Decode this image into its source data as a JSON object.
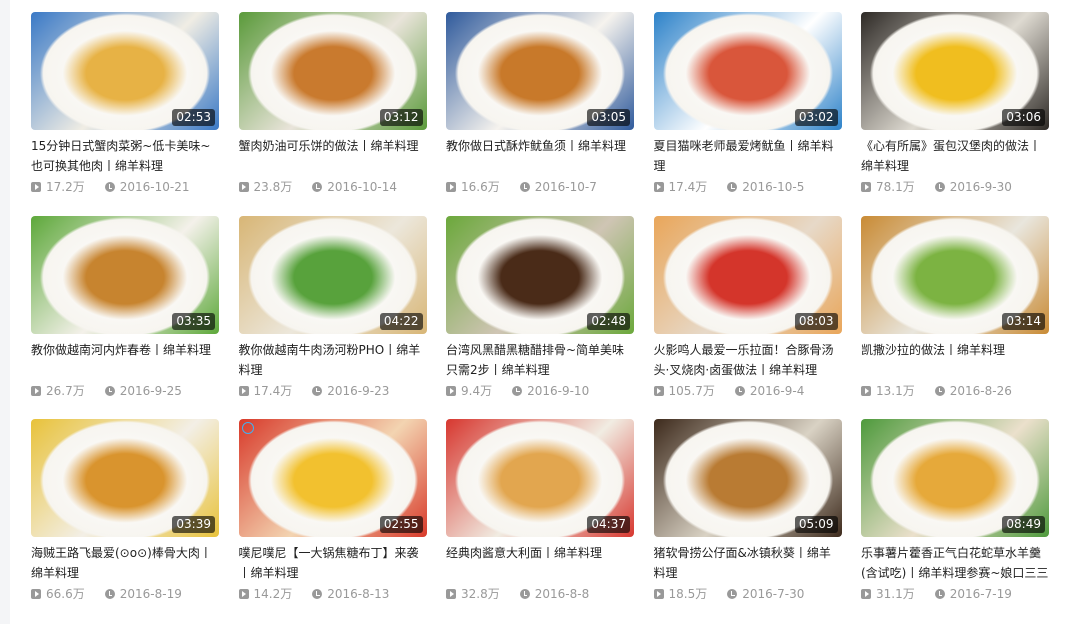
{
  "videos": [
    {
      "title": "15分钟日式蟹肉菜粥~低卡美味~也可换其他肉丨绵羊料理",
      "duration": "02:53",
      "plays": "17.2万",
      "date": "2016-10-21",
      "thumb_colors": [
        "#f0ede4",
        "#e7b245",
        "#3a79c6"
      ]
    },
    {
      "title": "蟹肉奶油可乐饼的做法丨绵羊料理",
      "duration": "03:12",
      "plays": "23.8万",
      "date": "2016-10-14",
      "thumb_colors": [
        "#e9e4da",
        "#c97a2e",
        "#5a9a3a"
      ]
    },
    {
      "title": "教你做日式酥炸鱿鱼须丨绵羊料理",
      "duration": "03:05",
      "plays": "16.6万",
      "date": "2016-10-7",
      "thumb_colors": [
        "#f6f3ee",
        "#c8792a",
        "#2f5a9c"
      ]
    },
    {
      "title": "夏目猫咪老师最爱烤鱿鱼丨绵羊料理",
      "duration": "03:02",
      "plays": "17.4万",
      "date": "2016-10-5",
      "thumb_colors": [
        "#ffffff",
        "#d9563b",
        "#2d82c9"
      ]
    },
    {
      "title": "《心有所属》蛋包汉堡肉的做法丨绵羊料理",
      "duration": "03:06",
      "plays": "78.1万",
      "date": "2016-9-30",
      "thumb_colors": [
        "#dedad1",
        "#f0be1f",
        "#2e2a26"
      ]
    },
    {
      "title": "教你做越南河内炸春卷丨绵羊料理",
      "duration": "03:35",
      "plays": "26.7万",
      "date": "2016-9-25",
      "thumb_colors": [
        "#f4f1ea",
        "#c7842f",
        "#5da83a"
      ]
    },
    {
      "title": "教你做越南牛肉汤河粉PHO丨绵羊料理",
      "duration": "04:22",
      "plays": "17.4万",
      "date": "2016-9-23",
      "thumb_colors": [
        "#ece7db",
        "#58a23c",
        "#d8b676"
      ]
    },
    {
      "title": "台湾风黑醋黑糖醋排骨~简单美味只需2步丨绵羊料理",
      "duration": "02:48",
      "plays": "9.4万",
      "date": "2016-9-10",
      "thumb_colors": [
        "#cfc5b4",
        "#4a2b18",
        "#6ba83b"
      ]
    },
    {
      "title": "火影鸣人最爱一乐拉面！合豚骨汤头·叉烧肉·卤蛋做法丨绵羊料理",
      "duration": "08:03",
      "plays": "105.7万",
      "date": "2016-9-4",
      "thumb_colors": [
        "#e7d9c8",
        "#d4352b",
        "#e9a65a"
      ]
    },
    {
      "title": "凯撒沙拉的做法丨绵羊料理",
      "duration": "03:14",
      "plays": "13.1万",
      "date": "2016-8-26",
      "thumb_colors": [
        "#e9e6dd",
        "#7cb342",
        "#c98b35"
      ]
    },
    {
      "title": "海贼王路飞最爱(⊙o⊙)棒骨大肉丨绵羊料理",
      "duration": "03:39",
      "plays": "66.6万",
      "date": "2016-8-19",
      "thumb_colors": [
        "#f3efe6",
        "#d9942e",
        "#e8c23a"
      ]
    },
    {
      "title": "噗尼噗尼【一大锅焦糖布丁】来袭丨绵羊料理",
      "duration": "02:55",
      "plays": "14.2万",
      "date": "2016-8-13",
      "thumb_colors": [
        "#f3d4b1",
        "#f2c12f",
        "#d83a2a"
      ]
    },
    {
      "title": "经典肉酱意大利面丨绵羊料理",
      "duration": "04:37",
      "plays": "32.8万",
      "date": "2016-8-8",
      "thumb_colors": [
        "#f1ece2",
        "#e2a64f",
        "#d7372f"
      ]
    },
    {
      "title": "猪软骨捞公仔面&冰镇秋葵丨绵羊料理",
      "duration": "05:09",
      "plays": "18.5万",
      "date": "2016-7-30",
      "thumb_colors": [
        "#d9d2c4",
        "#b97b33",
        "#3d2a1c"
      ]
    },
    {
      "title": "乐事薯片藿香正气白花蛇草水羊羹(含试吃)丨绵羊料理参赛~娘口三三",
      "duration": "08:49",
      "plays": "31.1万",
      "date": "2016-7-19",
      "thumb_colors": [
        "#ebe0cc",
        "#e6a93a",
        "#4e9a3c"
      ]
    }
  ]
}
